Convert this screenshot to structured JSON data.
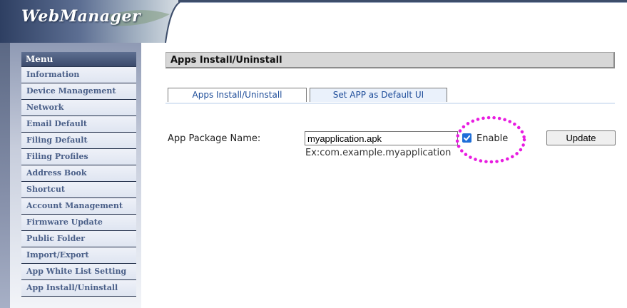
{
  "header": {
    "logo_text": "WebManager"
  },
  "sidebar": {
    "menu_title": "Menu",
    "items": [
      "Information",
      "Device Management",
      "Network",
      "Email Default",
      "Filing Default",
      "Filing Profiles",
      "Address Book",
      "Shortcut",
      "Account Management",
      "Firmware Update",
      "Public Folder",
      "Import/Export",
      "App White List Setting",
      "App Install/Uninstall"
    ]
  },
  "main": {
    "title": "Apps Install/Uninstall",
    "tabs": [
      {
        "label": "Apps Install/Uninstall"
      },
      {
        "label": "Set APP as Default UI"
      }
    ],
    "package_label": "App Package Name:",
    "package_value": "myapplication.apk",
    "hint": "Ex:com.example.myapplication",
    "enable_label": "Enable",
    "enable_checked": true,
    "update_label": "Update",
    "highlight_color": "#e81ce0"
  }
}
